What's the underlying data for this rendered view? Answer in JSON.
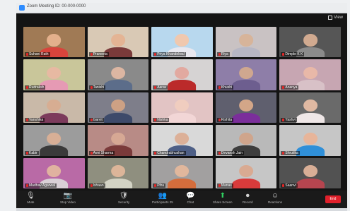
{
  "window": {
    "title": "Zoom Meeting ID: 00-000-0000"
  },
  "view_button": {
    "label": "View"
  },
  "participants": [
    {
      "name": "Suhani Rath",
      "bg": "#a07a55",
      "skin": "#e3b08c",
      "shirt": "#d8443c",
      "muted": true
    },
    {
      "name": "Praneeta",
      "bg": "#d9c9b5",
      "skin": "#e4b494",
      "shirt": "#7a3a3a",
      "muted": true
    },
    {
      "name": "Priya Khandelwal",
      "bg": "#b8d8ee",
      "skin": "#f0c8ae",
      "shirt": "#e8e8ef",
      "muted": true
    },
    {
      "name": "Riya",
      "bg": "#c9c2c3",
      "skin": "#d7b49a",
      "shirt": "#b7b7c4",
      "muted": true
    },
    {
      "name": "Dimple K K",
      "bg": "#565656",
      "skin": "#d1aa90",
      "shirt": "#8b8b8b",
      "muted": true
    },
    {
      "name": "Rudraksh",
      "bg": "#c9c69a",
      "skin": "#e7b9a2",
      "shirt": "#e69ab4",
      "muted": true
    },
    {
      "name": "Tanishi",
      "bg": "#8a8a8a",
      "skin": "#dcb6a2",
      "shirt": "#5c6d8a",
      "muted": true
    },
    {
      "name": "Aarav",
      "bg": "#d6d3d3",
      "skin": "#e2a9a0",
      "shirt": "#bb2a2a",
      "muted": true
    },
    {
      "name": "Khushi",
      "bg": "#8e7ea8",
      "skin": "#cfa78f",
      "shirt": "#6d5e8f",
      "muted": true
    },
    {
      "name": "Ananya",
      "bg": "#c7a6b2",
      "skin": "#e8b8a8",
      "shirt": "#d8c1c7",
      "muted": true
    },
    {
      "name": "Vanshika",
      "bg": "#c9b9a8",
      "skin": "#d7ad92",
      "shirt": "#7c3b5c",
      "muted": true
    },
    {
      "name": "Garvit",
      "bg": "#7e7e8a",
      "skin": "#cda184",
      "shirt": "#3d4a6a",
      "muted": true
    },
    {
      "name": "Nishka",
      "bg": "#e2c4c4",
      "skin": "#f0cdbf",
      "shirt": "#f2d6d6",
      "muted": true
    },
    {
      "name": "Rishita",
      "bg": "#5f5f6e",
      "skin": "#d3a688",
      "shirt": "#7b2e9b",
      "muted": true
    },
    {
      "name": "Yashvi",
      "bg": "#6a6a6a",
      "skin": "#e0b9a2",
      "shirt": "#efe7e7",
      "muted": true
    },
    {
      "name": "Kabir",
      "bg": "#9c9c9c",
      "skin": "#d8af96",
      "shirt": "#3a3a3a",
      "muted": true
    },
    {
      "name": "Avni Sharma",
      "bg": "#b88b86",
      "skin": "#d6a894",
      "shirt": "#7a3a3a",
      "muted": true
    },
    {
      "name": "Chandrabhushan",
      "bg": "#d9d9d9",
      "skin": "#dcb098",
      "shirt": "#4e5f86",
      "muted": true
    },
    {
      "name": "Devansh Jain",
      "bg": "#b9b9b9",
      "skin": "#cfa58c",
      "shirt": "#3d3d3d",
      "muted": true
    },
    {
      "name": "Shrutika",
      "bg": "#c6c6c6",
      "skin": "#e7b59a",
      "shirt": "#2f8fd8",
      "muted": true
    },
    {
      "name": "Madhav Agarwal",
      "bg": "#b96aa6",
      "skin": "#e0b2a0",
      "shirt": "#d9d0d6",
      "muted": true
    },
    {
      "name": "Ishaan",
      "bg": "#8f8f7f",
      "skin": "#dcb599",
      "shirt": "#d3d3c4",
      "muted": true
    },
    {
      "name": "Pihu",
      "bg": "#a2a0a0",
      "skin": "#e1b79c",
      "shirt": "#d46d3c",
      "muted": true
    },
    {
      "name": "Manas",
      "bg": "#c6c6c6",
      "skin": "#d9aa92",
      "shirt": "#d83b3b",
      "muted": true
    },
    {
      "name": "Saanvi",
      "bg": "#525252",
      "skin": "#d8ae96",
      "shirt": "#b6454f",
      "muted": true
    }
  ],
  "toolbar": {
    "items": [
      {
        "label": "Mute",
        "glyph": "🎙",
        "green": false
      },
      {
        "label": "Stop Video",
        "glyph": "📷",
        "green": false
      },
      {
        "label": "Security",
        "glyph": "🛡",
        "green": false
      },
      {
        "label": "Participants 25",
        "glyph": "👥",
        "green": false
      },
      {
        "label": "Chat",
        "glyph": "💬",
        "green": false
      },
      {
        "label": "Share Screen",
        "glyph": "⬆",
        "green": true
      },
      {
        "label": "Record",
        "glyph": "⏺",
        "green": false
      },
      {
        "label": "Reactions",
        "glyph": "☺",
        "green": false
      }
    ],
    "end_label": "End"
  }
}
